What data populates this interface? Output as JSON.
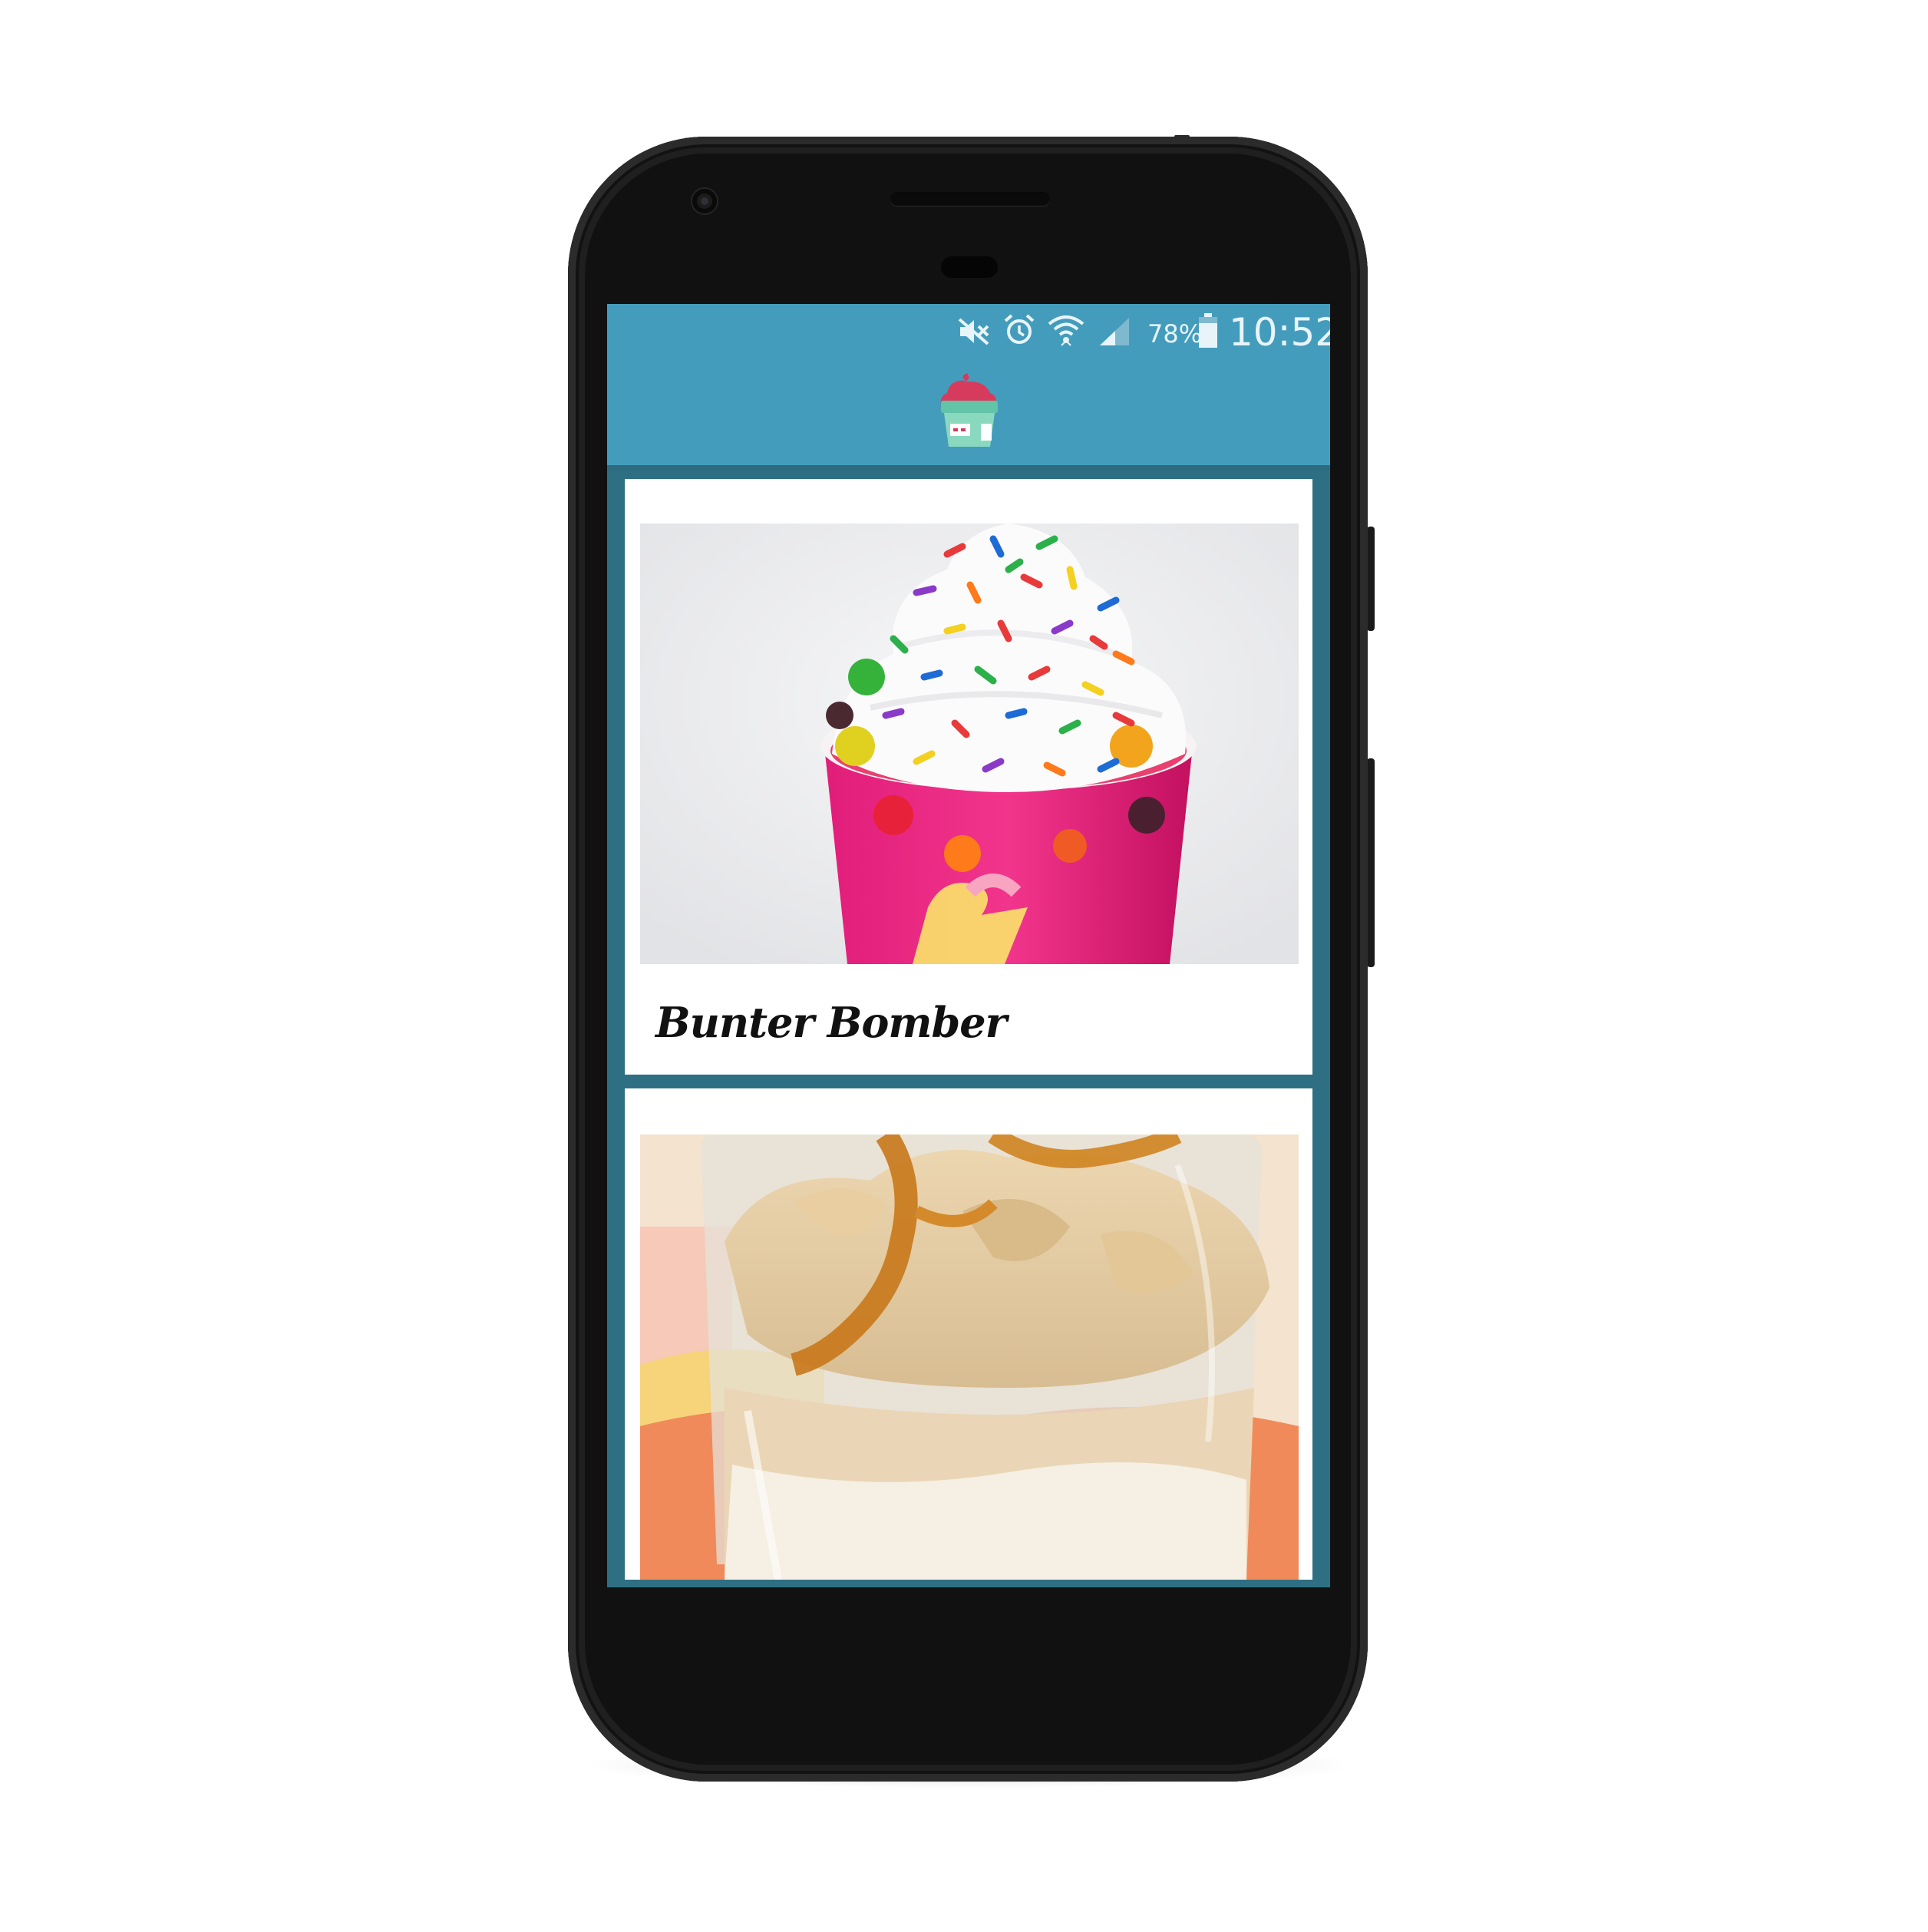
{
  "status_bar": {
    "icons": [
      "mute-icon",
      "alarm-icon",
      "wifi-icon",
      "signal-icon",
      "battery-icon"
    ],
    "battery_percent": "78%",
    "time": "10:52"
  },
  "app_bar": {
    "logo_icon": "frozen-yogurt-cup-icon",
    "color": "#449cbc"
  },
  "list": {
    "background_color": "#2f6f84",
    "items": [
      {
        "title": "Bunter Bomber",
        "image": "frozen-yogurt-with-sprinkles-and-gummy-bears"
      },
      {
        "title": "",
        "image": "caramel-ice-cream-glass"
      }
    ]
  }
}
